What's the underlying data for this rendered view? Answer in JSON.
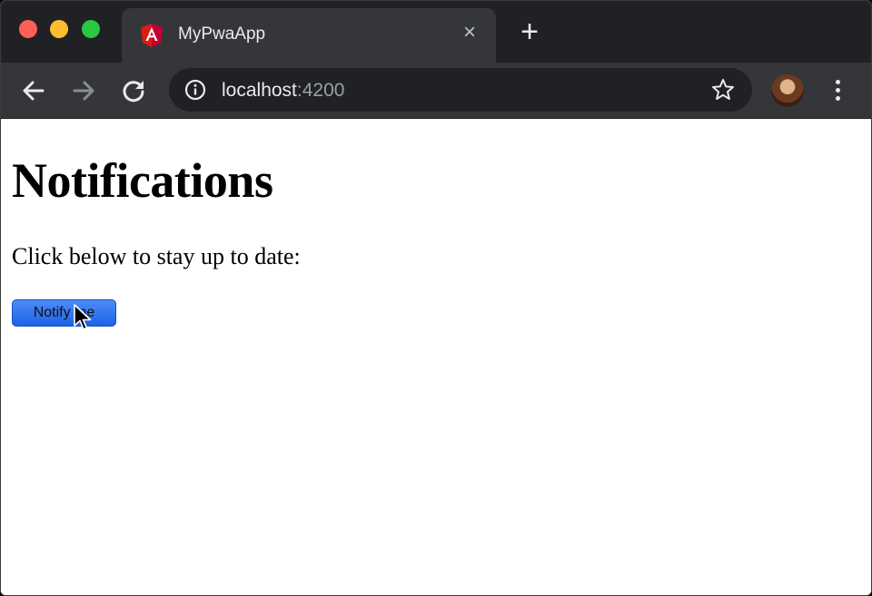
{
  "browser": {
    "tab": {
      "title": "MyPwaApp",
      "close_glyph": "×",
      "favicon": "angular-logo-icon"
    },
    "new_tab_glyph": "+",
    "address": {
      "host": "localhost",
      "port": ":4200"
    },
    "colors": {
      "tabstrip": "#202124",
      "toolbar": "#35363a",
      "omnibox": "#202124"
    }
  },
  "page": {
    "heading": "Notifications",
    "lead": "Click below to stay up to date:",
    "notify_button_label": "Notify me",
    "button_color": "#1b63e6"
  }
}
